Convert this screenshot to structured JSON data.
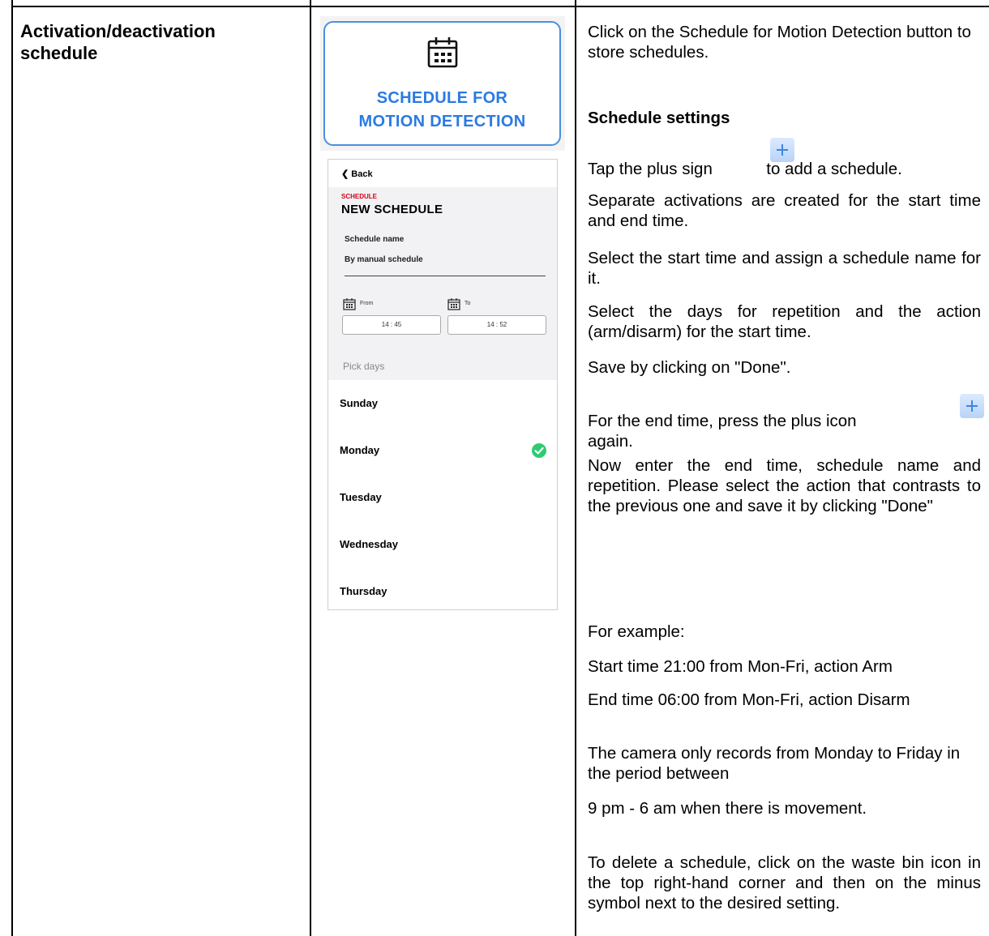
{
  "row_header": "Activation/deactivation schedule",
  "schedule_button": {
    "icon": "calendar-icon",
    "label_line1": "SCHEDULE FOR",
    "label_line2": "MOTION DETECTION"
  },
  "phone": {
    "back_label": "Back",
    "kicker": "SCHEDULE",
    "title": "NEW SCHEDULE",
    "name_label": "Schedule name",
    "name_value": "By manual schedule",
    "from_label": "From",
    "to_label": "To",
    "from_time": "14 : 45",
    "to_time": "14 : 52",
    "pick_days": "Pick days",
    "days": [
      "Sunday",
      "Monday",
      "Tuesday",
      "Wednesday",
      "Thursday"
    ],
    "checked_day": "Monday",
    "accent_color": "#d0021b",
    "check_color": "#2ecc71"
  },
  "instructions": {
    "intro": "Click on the Schedule for Motion Detection button to store schedules.",
    "heading": "Schedule settings",
    "tap_plus_a": "Tap the plus sign",
    "tap_plus_b": "to add a schedule.",
    "p1": "Separate activations are created for the start time and end time.",
    "p2": "Select the start time and assign a schedule name for it.",
    "p3": "Select the days for repetition and the action (arm/disarm) for the start time.",
    "p4": "Save by clicking on \"Done\".",
    "end_a": "For the end time, press the plus icon",
    "end_b": "again.",
    "p5": "Now enter the end time, schedule name and repetition. Please select the action that contrasts to the previous one and save it by clicking \"Done\"",
    "example_head": "For example:",
    "ex1": "Start time 21:00 from Mon-Fri, action Arm",
    "ex2": "End time 06:00 from Mon-Fri, action Disarm",
    "ex3": "The camera only records from Monday to Friday in the period between",
    "ex4": "9 pm - 6 am when there is movement.",
    "delete": "To delete a schedule, click on the waste bin icon in the top right-hand corner and then on the minus symbol next to the desired setting."
  }
}
